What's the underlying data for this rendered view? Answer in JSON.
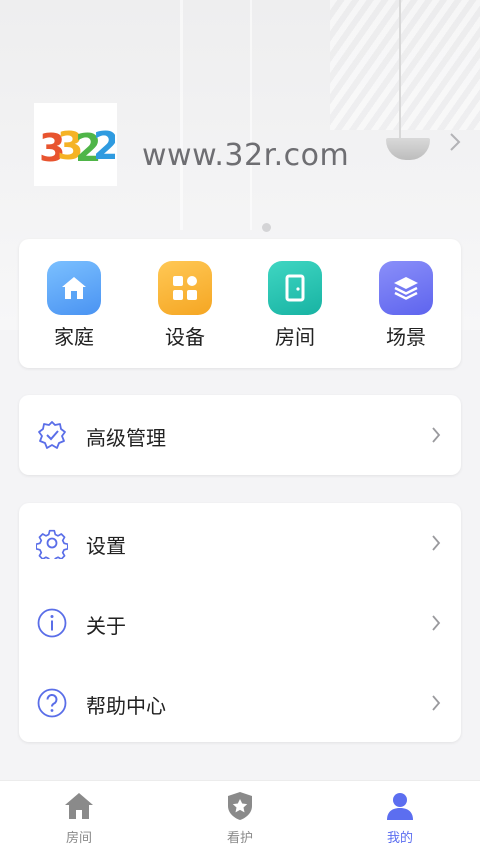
{
  "profile": {
    "site_name": "www.32r.com",
    "avatar_logo_text": "3322"
  },
  "quick_actions": [
    {
      "label": "家庭",
      "icon": "home-icon",
      "color": "#4f9cf5"
    },
    {
      "label": "设备",
      "icon": "devices-grid-icon",
      "color": "#f5b034"
    },
    {
      "label": "房间",
      "icon": "door-icon",
      "color": "#27c2b1"
    },
    {
      "label": "场景",
      "icon": "layers-icon",
      "color": "#6d72f5"
    }
  ],
  "advanced": {
    "label": "高级管理",
    "icon": "shield-check-icon"
  },
  "menu": [
    {
      "label": "设置",
      "icon": "gear-icon"
    },
    {
      "label": "关于",
      "icon": "info-icon"
    },
    {
      "label": "帮助中心",
      "icon": "help-icon"
    }
  ],
  "tabbar": [
    {
      "label": "房间",
      "icon": "home-icon",
      "active": false
    },
    {
      "label": "看护",
      "icon": "shield-star-icon",
      "active": false
    },
    {
      "label": "我的",
      "icon": "user-icon",
      "active": true
    }
  ],
  "colors": {
    "accent": "#5c6ef0",
    "icon_outline": "#5a6ee8",
    "inactive": "#8a8a8a"
  }
}
